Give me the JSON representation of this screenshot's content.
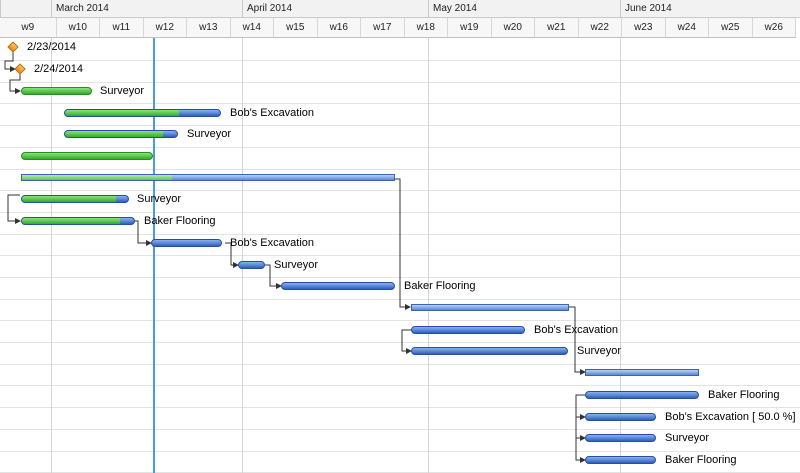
{
  "timeline": {
    "months": [
      "March 2014",
      "April 2014",
      "May 2014",
      "June 2014"
    ],
    "weeks": [
      "w9",
      "w10",
      "w11",
      "w12",
      "w13",
      "w14",
      "w15",
      "w16",
      "w17",
      "w18",
      "w19",
      "w20",
      "w21",
      "w22",
      "w23",
      "w24",
      "w25",
      "w26"
    ]
  },
  "labels": {
    "m1": "2/23/2014",
    "m2": "2/24/2014",
    "r3": "Surveyor",
    "r4": "Bob's Excavation",
    "r5": "Surveyor",
    "r9": "Surveyor",
    "r10": "Baker Flooring",
    "r11": "Bob's Excavation",
    "r12": "Surveyor",
    "r13": "Baker Flooring",
    "r15": "Bob's Excavation",
    "r16": "Surveyor",
    "r18": "Baker Flooring",
    "r19": "Bob's Excavation [ 50.0 %]",
    "r20": "Surveyor",
    "r21": "Baker Flooring"
  },
  "colors": {
    "done": "#2fae24",
    "remaining": "#2d5fc1",
    "milestone": "#e88a10",
    "today_line": "#4a9be0"
  }
}
